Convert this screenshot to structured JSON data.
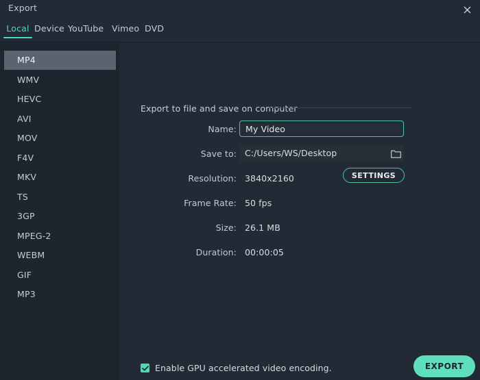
{
  "window": {
    "title": "Export",
    "close_icon": "close-icon"
  },
  "tabs": [
    {
      "id": "local",
      "label": "Local",
      "active": true
    },
    {
      "id": "device",
      "label": "Device",
      "active": false
    },
    {
      "id": "youtube",
      "label": "YouTube",
      "active": false
    },
    {
      "id": "vimeo",
      "label": "Vimeo",
      "active": false
    },
    {
      "id": "dvd",
      "label": "DVD",
      "active": false
    }
  ],
  "sidebar": {
    "selected": "MP4",
    "formats": [
      {
        "label": "MP4"
      },
      {
        "label": "WMV"
      },
      {
        "label": "HEVC"
      },
      {
        "label": "AVI"
      },
      {
        "label": "MOV"
      },
      {
        "label": "F4V"
      },
      {
        "label": "MKV"
      },
      {
        "label": "TS"
      },
      {
        "label": "3GP"
      },
      {
        "label": "MPEG-2"
      },
      {
        "label": "WEBM"
      },
      {
        "label": "GIF"
      },
      {
        "label": "MP3"
      }
    ]
  },
  "main": {
    "section_header": "Export to file and save on computer",
    "fields": {
      "name_label": "Name:",
      "name_value": "My Video",
      "name_placeholder": "My Video",
      "saveto_label": "Save to:",
      "saveto_value": "C:/Users/WS/Desktop",
      "folder_icon": "folder-icon",
      "resolution_label": "Resolution:",
      "resolution_value": "3840x2160",
      "settings_label": "SETTINGS",
      "framerate_label": "Frame Rate:",
      "framerate_value": "50 fps",
      "size_label": "Size:",
      "size_value": "26.1 MB",
      "duration_label": "Duration:",
      "duration_value": "00:00:05"
    }
  },
  "footer": {
    "gpu_label": "Enable GPU accelerated video encoding.",
    "gpu_checked": true,
    "export_label": "EXPORT"
  },
  "colors": {
    "accent": "#4fd9b6",
    "accent_button": "#5fe0bd",
    "window_bg": "#222b35",
    "sidebar_bg": "#1e252e",
    "selected_row": "#5a636f"
  }
}
